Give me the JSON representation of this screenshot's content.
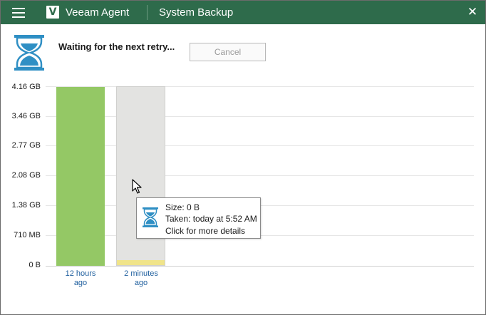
{
  "window": {
    "app_name": "Veeam Agent",
    "logo_letter": "V",
    "section_title": "System Backup"
  },
  "icons": {
    "menu": "hamburger-menu-icon",
    "logo": "veeam-logo-icon",
    "close": "close-icon",
    "status": "hourglass-icon",
    "cursor": "mouse-pointer-icon"
  },
  "colors": {
    "titlebar": "#2e6b4b",
    "bar_complete": "#94c865",
    "bar_pending": "#e3e3e1",
    "bar_pending_fill": "#f0e48a",
    "hourglass": "#2f8fc4",
    "link": "#1f5f9e"
  },
  "status": {
    "text": "Waiting for the next retry...",
    "cancel_label": "Cancel"
  },
  "chart_data": {
    "type": "bar",
    "y_ticks": [
      "4.16 GB",
      "3.46 GB",
      "2.77 GB",
      "2.08 GB",
      "1.38 GB",
      "710 MB",
      "0 B"
    ],
    "categories": [
      {
        "line1": "12 hours",
        "line2": "ago"
      },
      {
        "line1": "2 minutes",
        "line2": "ago"
      }
    ],
    "bars": [
      {
        "fill_fraction": 1.0,
        "state": "completed"
      },
      {
        "fill_fraction": 0.03,
        "state": "in-progress"
      }
    ]
  },
  "tooltip": {
    "size": "Size: 0 B",
    "taken": "Taken: today at 5:52 AM",
    "details": "Click for more details"
  }
}
